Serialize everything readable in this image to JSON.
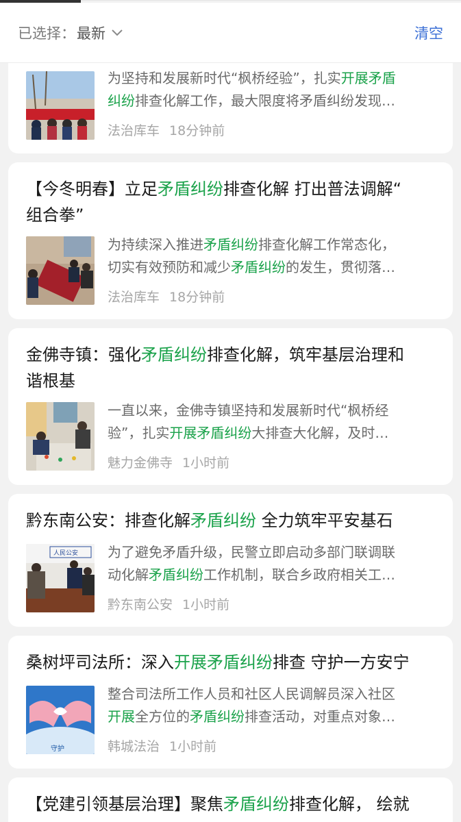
{
  "filter": {
    "prefix": "已选择：",
    "value": "最新",
    "clear_label": "清空"
  },
  "articles": [
    {
      "title_parts": [],
      "snippet_line1": [
        {
          "t": "为坚持和发展新时代“枫桥经验”，扎实",
          "hl": false
        },
        {
          "t": "开展矛盾",
          "hl": true
        }
      ],
      "snippet_line2": [
        {
          "t": "纠纷",
          "hl": true
        },
        {
          "t": "排查化解工作，最大限度将矛盾纠纷发现…",
          "hl": false
        }
      ],
      "source": "法治库车",
      "time": "18分钟前"
    },
    {
      "title_line1": [
        {
          "t": "【今冬明春】立足",
          "hl": false
        },
        {
          "t": "矛盾纠纷",
          "hl": true
        },
        {
          "t": "排查化解 打出普法调解“",
          "hl": false
        }
      ],
      "title_line2": [
        {
          "t": "组合拳”",
          "hl": false
        }
      ],
      "snippet_line1": [
        {
          "t": "为持续深入推进",
          "hl": false
        },
        {
          "t": "矛盾纠纷",
          "hl": true
        },
        {
          "t": "排查化解工作常态化，",
          "hl": false
        }
      ],
      "snippet_line2": [
        {
          "t": "切实有效预防和减少",
          "hl": false
        },
        {
          "t": "矛盾纠纷",
          "hl": true
        },
        {
          "t": "的发生，贯彻落…",
          "hl": false
        }
      ],
      "source": "法治库车",
      "time": "18分钟前"
    },
    {
      "title_line1": [
        {
          "t": "金佛寺镇：强化",
          "hl": false
        },
        {
          "t": "矛盾纠纷",
          "hl": true
        },
        {
          "t": "排查化解，筑牢基层治理和",
          "hl": false
        }
      ],
      "title_line2": [
        {
          "t": "谐根基",
          "hl": false
        }
      ],
      "snippet_line1": [
        {
          "t": "一直以来，金佛寺镇坚持和发展新时代“枫桥经",
          "hl": false
        }
      ],
      "snippet_line2": [
        {
          "t": "验”，扎实",
          "hl": false
        },
        {
          "t": "开展矛盾纠纷",
          "hl": true
        },
        {
          "t": "大排查大化解，及时…",
          "hl": false
        }
      ],
      "source": "魅力金佛寺",
      "time": "1小时前"
    },
    {
      "title_line1": [
        {
          "t": "黔东南公安：排查化解",
          "hl": false
        },
        {
          "t": "矛盾纠纷",
          "hl": true
        },
        {
          "t": " 全力筑牢平安基石",
          "hl": false
        }
      ],
      "snippet_line1": [
        {
          "t": "为了避免矛盾升级，民警立即启动多部门联调联",
          "hl": false
        }
      ],
      "snippet_line2": [
        {
          "t": "动化解",
          "hl": false
        },
        {
          "t": "矛盾纠纷",
          "hl": true
        },
        {
          "t": "工作机制，联合乡政府相关工…",
          "hl": false
        }
      ],
      "source": "黔东南公安",
      "time": "1小时前"
    },
    {
      "title_line1": [
        {
          "t": "桑树坪司法所：深入",
          "hl": false
        },
        {
          "t": "开展矛盾纠纷",
          "hl": true
        },
        {
          "t": "排查 守护一方安宁",
          "hl": false
        }
      ],
      "snippet_line1": [
        {
          "t": "整合司法所工作人员和社区人民调解员深入社区",
          "hl": false
        }
      ],
      "snippet_line2": [
        {
          "t": "开展",
          "hl": true
        },
        {
          "t": "全方位的",
          "hl": false
        },
        {
          "t": "矛盾纠纷",
          "hl": true
        },
        {
          "t": "排查活动，对重点对象…",
          "hl": false
        }
      ],
      "thumb_text": "守护",
      "source": "韩城法治",
      "time": "1小时前"
    },
    {
      "title_line1": [
        {
          "t": "【党建引领基层治理】聚焦",
          "hl": false
        },
        {
          "t": "矛盾纠纷",
          "hl": true
        },
        {
          "t": "排查化解， 绘就",
          "hl": false
        }
      ]
    }
  ],
  "colors": {
    "highlight": "#1aa24a",
    "clear_link": "#3b6fd6",
    "background": "#f2f2f2"
  }
}
